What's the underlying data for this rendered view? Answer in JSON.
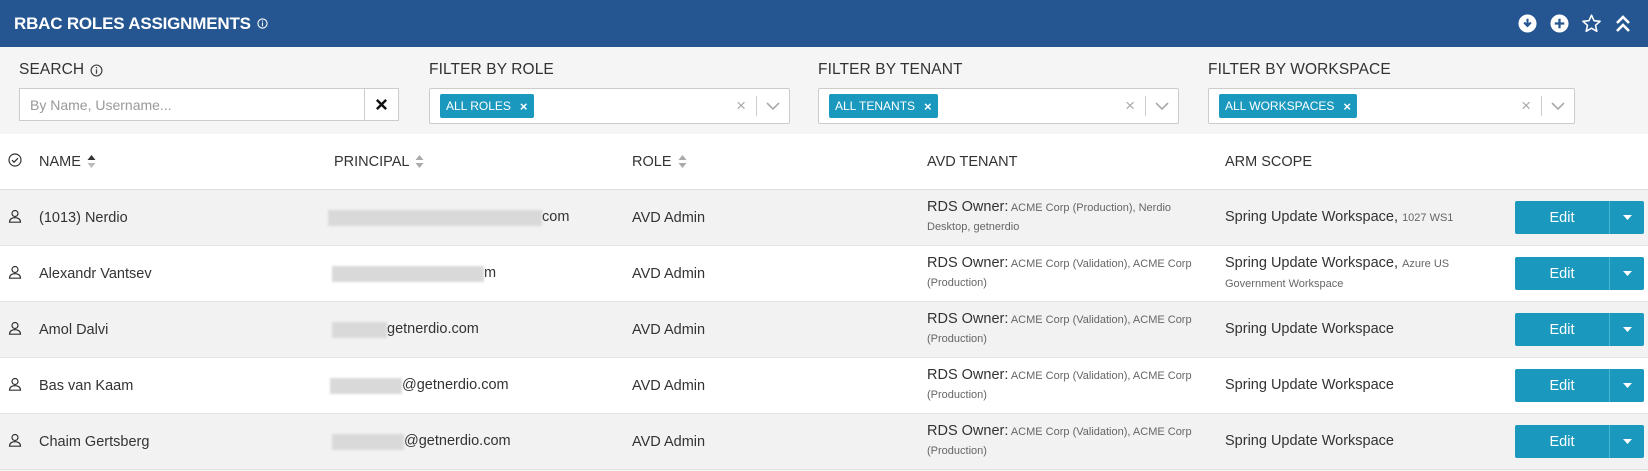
{
  "header": {
    "title": "RBAC ROLES ASSIGNMENTS",
    "actions": [
      "download-icon",
      "add-icon",
      "star-icon",
      "collapse-icon"
    ]
  },
  "filters": {
    "search": {
      "label": "SEARCH",
      "placeholder": "By Name, Username...",
      "value": ""
    },
    "role": {
      "label": "FILTER BY ROLE",
      "tag": "ALL ROLES"
    },
    "tenant": {
      "label": "FILTER BY TENANT",
      "tag": "ALL TENANTS"
    },
    "workspace": {
      "label": "FILTER BY WORKSPACE",
      "tag": "ALL WORKSPACES"
    }
  },
  "table": {
    "columns": [
      "NAME",
      "PRINCIPAL",
      "ROLE",
      "AVD TENANT",
      "ARM SCOPE"
    ],
    "rows": [
      {
        "name": "(1013) Nerdio",
        "principal_suffix": "com",
        "role": "AVD Admin",
        "tenant_prefix": "RDS Owner:",
        "tenant_detail": "ACME Corp (Production), Nerdio Desktop, getnerdio",
        "scope": "Spring Update Workspace,",
        "scope_detail": "1027 WS1",
        "edit": "Edit"
      },
      {
        "name": "Alexandr Vantsev",
        "principal_suffix": "m",
        "role": "AVD Admin",
        "tenant_prefix": "RDS Owner:",
        "tenant_detail": "ACME Corp (Validation), ACME Corp (Production)",
        "scope": "Spring Update Workspace,",
        "scope_detail": "Azure US Government Workspace",
        "edit": "Edit"
      },
      {
        "name": "Amol Dalvi",
        "principal_suffix": "getnerdio.com",
        "role": "AVD Admin",
        "tenant_prefix": "RDS Owner:",
        "tenant_detail": "ACME Corp (Validation), ACME Corp (Production)",
        "scope": "Spring Update Workspace",
        "scope_detail": "",
        "edit": "Edit"
      },
      {
        "name": "Bas van Kaam",
        "principal_suffix": "@getnerdio.com",
        "role": "AVD Admin",
        "tenant_prefix": "RDS Owner:",
        "tenant_detail": "ACME Corp (Validation), ACME Corp (Production)",
        "scope": "Spring Update Workspace",
        "scope_detail": "",
        "edit": "Edit"
      },
      {
        "name": "Chaim Gertsberg",
        "principal_suffix": "@getnerdio.com",
        "role": "AVD Admin",
        "tenant_prefix": "RDS Owner:",
        "tenant_detail": "ACME Corp (Validation), ACME Corp (Production)",
        "scope": "Spring Update Workspace",
        "scope_detail": "",
        "edit": "Edit"
      }
    ]
  },
  "colors": {
    "header_bg": "#255691",
    "accent": "#1b98be"
  }
}
